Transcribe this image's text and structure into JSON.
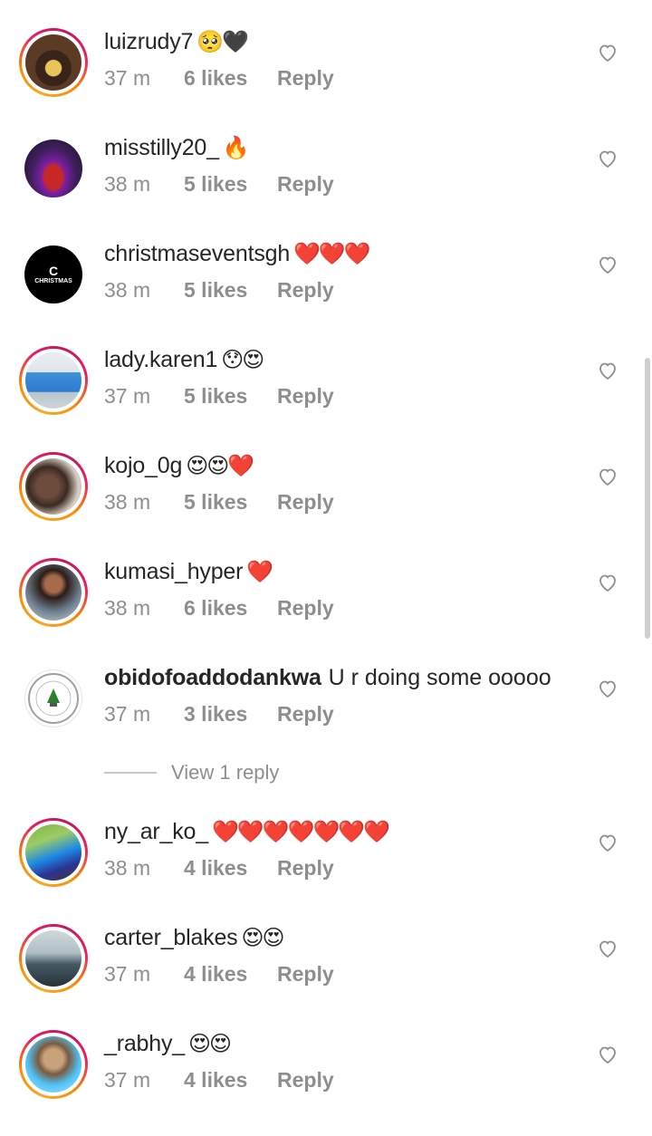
{
  "comments": [
    {
      "username": "luizrudy7",
      "emoji": "🥺🖤",
      "text": "",
      "time": "37 m",
      "likes": "6 likes",
      "reply": "Reply",
      "avatar": "gold-teeth-photo",
      "ring": true
    },
    {
      "username": "misstilly20_",
      "emoji": "🔥",
      "text": "",
      "time": "38 m",
      "likes": "5 likes",
      "reply": "Reply",
      "avatar": "woman-red-dress-photo",
      "ring": false
    },
    {
      "username": "christmaseventsgh",
      "emoji": "❤️❤️❤️",
      "text": "",
      "time": "38 m",
      "likes": "5 likes",
      "reply": "Reply",
      "avatar": "christmas-events-logo",
      "avatar_text": "CHRISTMAS",
      "ring": false
    },
    {
      "username": "lady.karen1",
      "emoji": "😯😍",
      "text": "",
      "time": "37 m",
      "likes": "5 likes",
      "reply": "Reply",
      "avatar": "woman-blue-outfit-photo",
      "ring": true
    },
    {
      "username": "kojo_0g",
      "emoji": "😍😍❤️",
      "text": "",
      "time": "38 m",
      "likes": "5 likes",
      "reply": "Reply",
      "avatar": "man-selfie-photo",
      "ring": true
    },
    {
      "username": "kumasi_hyper",
      "emoji": "❤️",
      "text": "",
      "time": "38 m",
      "likes": "6 likes",
      "reply": "Reply",
      "avatar": "woman-curly-hair-photo",
      "ring": true
    },
    {
      "username": "obidofoaddodankwa",
      "emoji": "",
      "text": "U r doing some ooooo",
      "time": "37 m",
      "likes": "3 likes",
      "reply": "Reply",
      "avatar": "school-crest-logo",
      "ring": false
    },
    {
      "username": "ny_ar_ko_",
      "emoji": "❤️❤️❤️❤️❤️❤️❤️",
      "text": "",
      "time": "38 m",
      "likes": "4 likes",
      "reply": "Reply",
      "avatar": "person-outdoors-photo",
      "ring": true
    },
    {
      "username": "carter_blakes",
      "emoji": "😍😍",
      "text": "",
      "time": "37 m",
      "likes": "4 likes",
      "reply": "Reply",
      "avatar": "man-standing-photo",
      "ring": true
    },
    {
      "username": "_rabhy_",
      "emoji": "😍😍",
      "text": "",
      "time": "37 m",
      "likes": "4 likes",
      "reply": "Reply",
      "avatar": "woman-selfie-photo",
      "ring": true
    }
  ],
  "view_replies": "View 1 reply",
  "icons": {
    "like": "heart-outline-icon"
  },
  "colors": {
    "text": "#262626",
    "meta": "#8e8e8e",
    "ring_start": "#f9a825",
    "ring_end": "#e91e63"
  }
}
